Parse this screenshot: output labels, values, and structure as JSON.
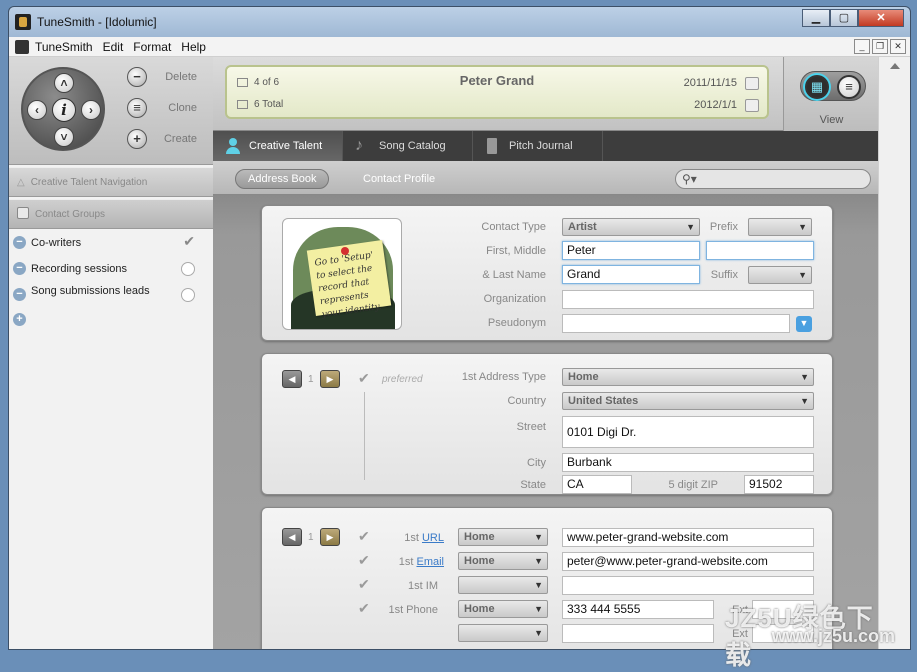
{
  "window": {
    "title": "TuneSmith - [Idolumic]"
  },
  "menu": {
    "items": [
      "TuneSmith",
      "Edit",
      "Format",
      "Help"
    ]
  },
  "controls": {
    "delete": "Delete",
    "clone": "Clone",
    "create": "Create"
  },
  "record": {
    "position": "4 of 6",
    "total": "6 Total",
    "name": "Peter Grand",
    "date1": "2011/11/15",
    "date2": "2012/1/1"
  },
  "view": {
    "label": "View"
  },
  "tabs": [
    {
      "label": "Creative Talent",
      "active": true,
      "icon": "person-icon"
    },
    {
      "label": "Song Catalog",
      "active": false,
      "icon": "music-note-icon"
    },
    {
      "label": "Pitch Journal",
      "active": false,
      "icon": "book-icon"
    }
  ],
  "subnav": {
    "address_book": "Address Book",
    "contact_profile": "Contact Profile"
  },
  "left": {
    "nav_header": "Creative Talent Navigation",
    "groups_header": "Contact Groups",
    "groups": [
      {
        "label": "Co-writers",
        "checked": true
      },
      {
        "label": "Recording sessions",
        "checked": false
      },
      {
        "label": "Song submissions leads",
        "checked": false
      }
    ]
  },
  "profile": {
    "contact_type_label": "Contact Type",
    "contact_type": "Artist",
    "prefix_label": "Prefix",
    "first_middle_label": "First, Middle",
    "first": "Peter",
    "middle": "",
    "last_label": "& Last Name",
    "last": "Grand",
    "suffix_label": "Suffix",
    "organization_label": "Organization",
    "organization": "",
    "pseudonym_label": "Pseudonym",
    "pseudonym": "",
    "photo_note": "Go to 'Setup' to select the record that represents your identity."
  },
  "address": {
    "index": "1",
    "preferred": "preferred",
    "type_label": "1st Address Type",
    "type": "Home",
    "country_label": "Country",
    "country": "United States",
    "street_label": "Street",
    "street": "0101 Digi Dr.",
    "city_label": "City",
    "city": "Burbank",
    "state_label": "State",
    "state": "CA",
    "zip_label": "5 digit ZIP",
    "zip": "91502"
  },
  "contact": {
    "index": "1",
    "url_prefix": "1st",
    "url_label": "URL",
    "url_type": "Home",
    "url": "www.peter-grand-website.com",
    "email_prefix": "1st",
    "email_label": "Email",
    "email_type": "Home",
    "email": "peter@www.peter-grand-website.com",
    "im_label": "1st IM",
    "im_type": "",
    "im": "",
    "phone_label": "1st Phone",
    "phone_type": "Home",
    "phone": "333 444 5555",
    "ext_label": "Ext",
    "phone2_type": "",
    "ext2_label": "Ext"
  },
  "watermark": {
    "line1": "JZ5U绿色下载",
    "line2": "www.jz5u.com"
  }
}
